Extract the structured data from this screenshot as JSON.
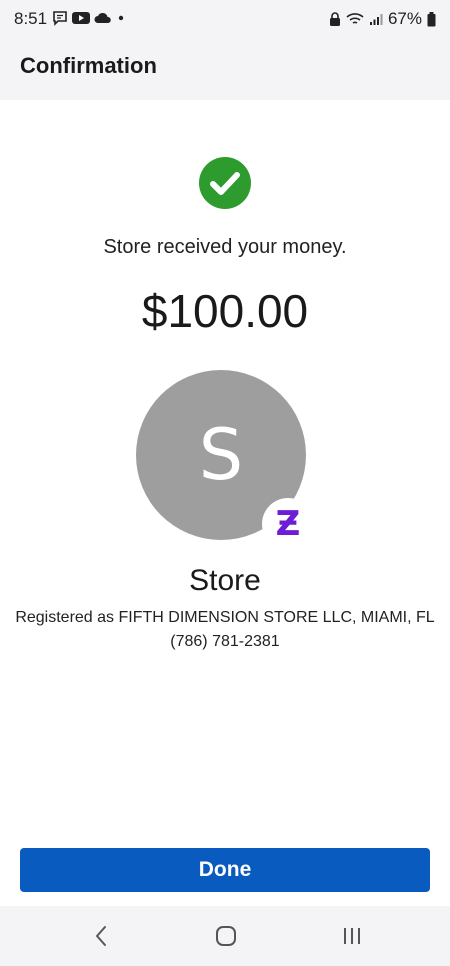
{
  "status_bar": {
    "time": "8:51",
    "battery": "67%"
  },
  "header": {
    "title": "Confirmation"
  },
  "confirmation": {
    "message": "Store received your money.",
    "amount": "$100.00",
    "avatar_initial": "S",
    "badge_glyph": "Ƶ",
    "recipient_name": "Store",
    "registered": "Registered as FIFTH DIMENSION STORE LLC, MIAMI, FL",
    "phone": "(786) 781-2381"
  },
  "actions": {
    "done_label": "Done"
  },
  "colors": {
    "success": "#2e9b2e",
    "primary_button": "#0a5bbf",
    "avatar": "#9e9e9e",
    "zelle": "#6d1ed4"
  },
  "icons": {
    "status_left": [
      "message-icon",
      "youtube-icon",
      "cloud-icon",
      "dot-icon"
    ],
    "status_right": [
      "lock-icon",
      "wifi-icon",
      "signal-icon",
      "battery-icon"
    ],
    "nav": [
      "back-icon",
      "home-icon",
      "recents-icon"
    ]
  }
}
